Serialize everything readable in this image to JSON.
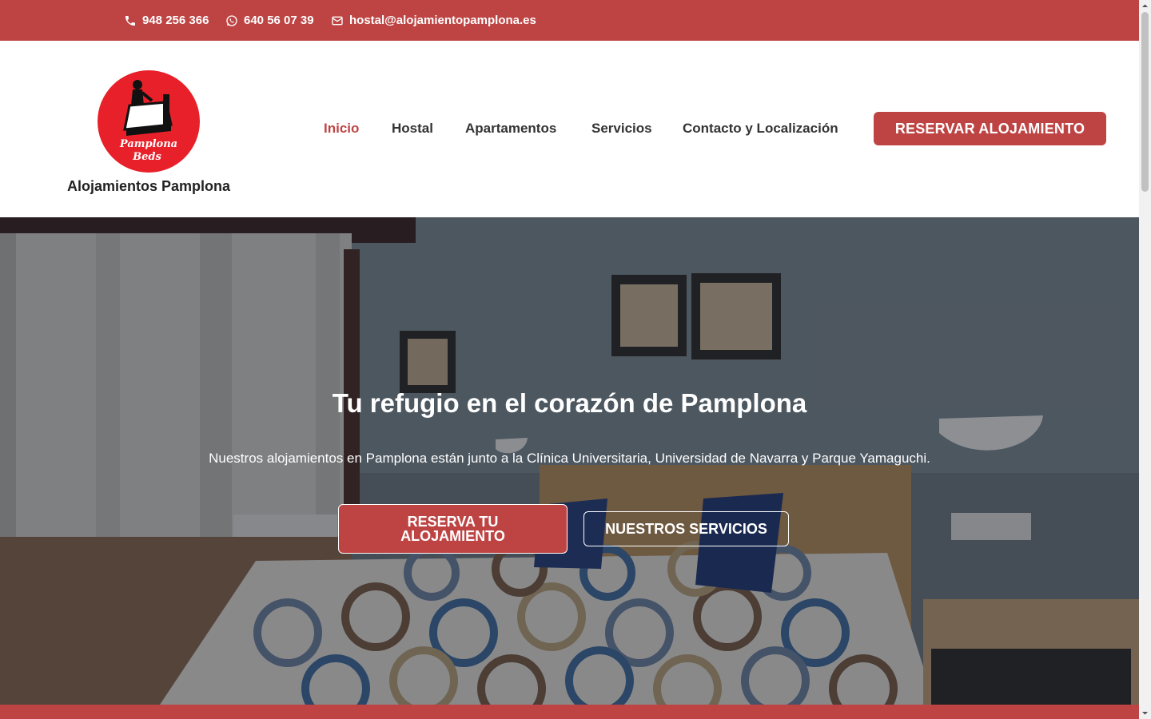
{
  "topbar": {
    "phone": "948 256 366",
    "whatsapp": "640 56 07 39",
    "email": "hostal@alojamientopamplona.es"
  },
  "header": {
    "logo_text": "Alojamientos Pamplona",
    "logo_badge_line1": "Pamplona",
    "logo_badge_line2": "Beds",
    "nav": [
      {
        "label": "Inicio",
        "active": true
      },
      {
        "label": "Hostal",
        "active": false
      },
      {
        "label": "Apartamentos",
        "active": false
      },
      {
        "label": "Servicios",
        "active": false
      },
      {
        "label": "Contacto y Localización",
        "active": false
      }
    ],
    "cta_label": "RESERVAR ALOJAMIENTO"
  },
  "hero": {
    "title": "Tu refugio en el corazón de Pamplona",
    "subtitle": "Nuestros alojamientos en Pamplona están junto a la Clínica Universitaria, Universidad de Navarra y Parque Yamaguchi.",
    "primary_button": "RESERVA TU ALOJAMIENTO",
    "secondary_button": "NUESTROS SERVICIOS"
  },
  "colors": {
    "brand": "#be4444",
    "logo_red": "#e8202a",
    "text_dark": "#333333"
  },
  "icons": {
    "phone": "phone-icon",
    "whatsapp": "whatsapp-icon",
    "email": "mail-icon"
  }
}
